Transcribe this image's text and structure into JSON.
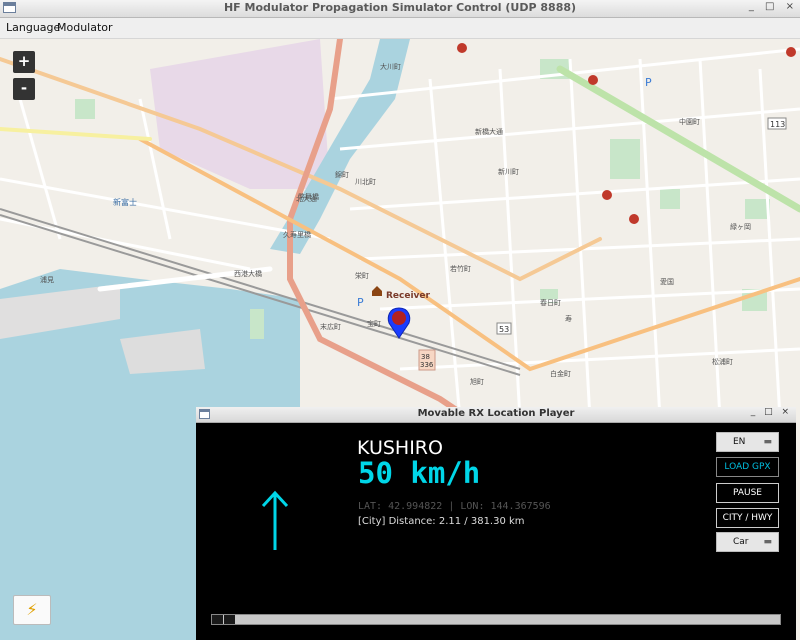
{
  "window": {
    "title": "HF Modulator Propagation Simulator Control (UDP 8888)",
    "buttons": "_ □ ×"
  },
  "menu": {
    "items": [
      "Language",
      "Modulator"
    ]
  },
  "map": {
    "zoom_in": "+",
    "zoom_out": "-",
    "receiver_label": "Receiver",
    "power_icon": "lightning-icon",
    "labels": [
      "新富士",
      "北大通",
      "錦町",
      "新川町",
      "中園町",
      "西港大橋",
      "久寿里橋",
      "幣舞橋",
      "末広町",
      "栄町",
      "浦見",
      "大川町",
      "川北町",
      "新橋大通",
      "寿",
      "松浦町",
      "旭町",
      "春日町",
      "若竹町",
      "白金町",
      "宝町",
      "緑ヶ岡",
      "愛国"
    ],
    "road_markers": [
      "53",
      "38",
      "336",
      "113"
    ]
  },
  "player": {
    "title": "Movable RX Location Player",
    "buttons": "_ □ ×",
    "city": "KUSHIRO",
    "speed": "50 km/h",
    "lat_label": "LAT: 42.994822",
    "separator": "|",
    "lon_label": "LON: 144.367596",
    "distance": "[City] Distance: 2.11 / 381.30 km",
    "progress": 0.04,
    "controls": {
      "language": "EN",
      "load_gpx": "LOAD GPX",
      "pause": "PAUSE",
      "mode": "CITY / HWY",
      "vehicle": "Car"
    }
  }
}
